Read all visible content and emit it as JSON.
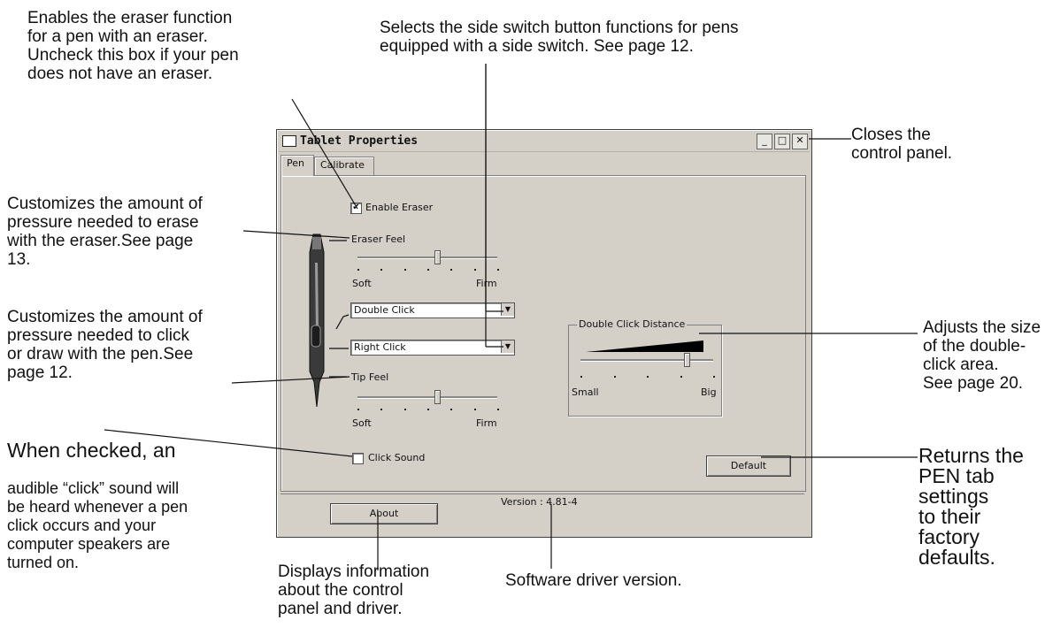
{
  "annotations": {
    "eraser_function": "Enables the eraser function\nfor a pen with an eraser.\nUncheck this box if your pen\ndoes not have an eraser.",
    "side_switch": "Selects the side switch button functions for pens\nequipped with a side switch. See page 12.",
    "closes": "Closes the\ncontrol panel.",
    "eraser_pressure": "Customizes the amount of\npressure needed to erase\nwith the eraser.See page\n13.",
    "tip_pressure": "Customizes the amount of\npressure needed to click\nor draw with the pen.See\npage 12.",
    "click_sound_lead": "When checked, an",
    "click_sound_rest": "audible “click” sound will\nbe heard whenever a pen\nclick occurs and your\ncomputer speakers are\nturned on.",
    "double_click_area": "Adjusts the size\nof the double-\nclick area.\nSee page 20.",
    "default_returns": "Returns the\nPEN tab settings\nto their factory\ndefaults.",
    "about_info": "Displays information\nabout the control\npanel and driver.",
    "driver_version": "Software driver version."
  },
  "window": {
    "title": "Tablet Properties",
    "minimize_glyph": "_",
    "maximize_glyph": "□",
    "close_glyph": "✕"
  },
  "tabs": [
    "Pen",
    "Calibrate"
  ],
  "pen_tab": {
    "enable_eraser": {
      "label": "Enable Eraser",
      "checked": true,
      "mark": "✔"
    },
    "eraser_feel": {
      "label": "Eraser Feel",
      "min_label": "Soft",
      "max_label": "Firm",
      "level": 0.57
    },
    "upper_switch": {
      "value": "Double Click"
    },
    "lower_switch": {
      "value": "Right Click"
    },
    "dropdown_glyph": "▼",
    "tip_feel": {
      "label": "Tip Feel",
      "min_label": "Soft",
      "max_label": "Firm",
      "level": 0.57
    },
    "click_sound": {
      "label": "Click Sound",
      "checked": false
    },
    "double_click_distance": {
      "label": "Double Click Distance",
      "min_label": "Small",
      "max_label": "Big",
      "level": 0.8
    },
    "default_button": "Default"
  },
  "footer": {
    "about_button": "About",
    "version": "Version : 4.81-4"
  },
  "colors": {
    "window_bg": "#d4d0c8",
    "text": "#111111"
  },
  "icons": [
    "window-icon",
    "pen-icon",
    "minimize-icon",
    "maximize-icon",
    "close-icon",
    "dropdown-arrow-icon",
    "checkmark-icon"
  ]
}
